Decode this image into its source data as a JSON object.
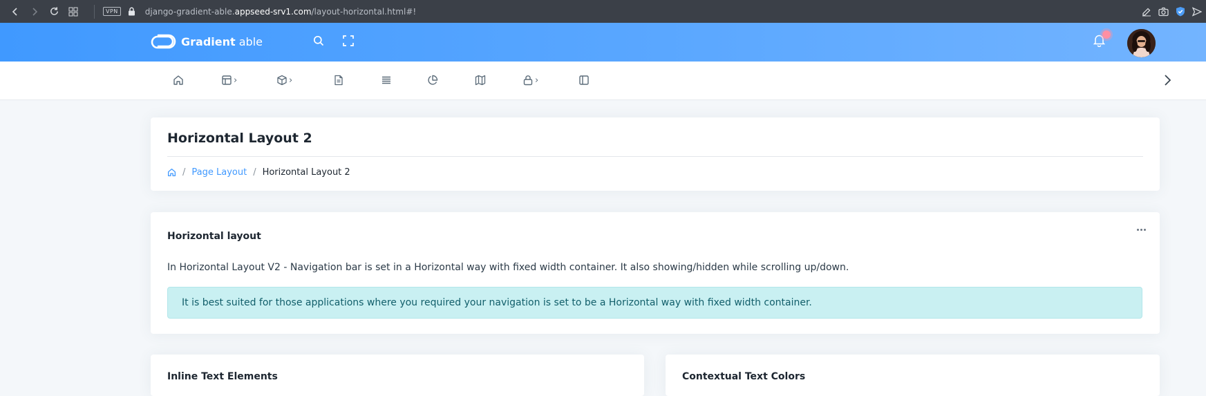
{
  "browser": {
    "vpn_label": "VPN",
    "url_prefix": "django-gradient-able.",
    "url_host": "appseed-srv1.com",
    "url_path": "/layout-horizontal.html#!"
  },
  "header": {
    "brand_bold": "Gradient",
    "brand_light": " able",
    "icons": [
      "search-icon",
      "fullscreen-icon",
      "bell-icon"
    ],
    "accent_color": "#4099ff"
  },
  "nav": {
    "items": [
      {
        "icon": "home-icon",
        "has_submenu": false
      },
      {
        "icon": "layout-icon",
        "has_submenu": true
      },
      {
        "icon": "box-icon",
        "has_submenu": true
      },
      {
        "icon": "file-text-icon",
        "has_submenu": false
      },
      {
        "icon": "list-icon",
        "has_submenu": false
      },
      {
        "icon": "pie-chart-icon",
        "has_submenu": false
      },
      {
        "icon": "map-icon",
        "has_submenu": false
      },
      {
        "icon": "lock-icon",
        "has_submenu": true
      },
      {
        "icon": "sidebar-icon",
        "has_submenu": false
      }
    ],
    "submenu_glyph": "›",
    "next_icon": "chevron-right-icon"
  },
  "page_header": {
    "title": "Horizontal Layout 2",
    "breadcrumb": {
      "home_icon": "home-icon",
      "separator": "/",
      "link": "Page Layout",
      "current": "Horizontal Layout 2"
    }
  },
  "layout_card": {
    "title": "Horizontal layout",
    "description": "In Horizontal Layout V2 - Navigation bar is set in a Horizontal way with fixed width container. It also showing/hidden while scrolling up/down.",
    "alert": "It is best suited for those applications where you required your navigation is set to be a Horizontal way with fixed width container.",
    "alert_color": "#c9f0f2"
  },
  "bottom_cards": [
    {
      "title": "Inline Text Elements"
    },
    {
      "title": "Contextual Text Colors"
    }
  ]
}
